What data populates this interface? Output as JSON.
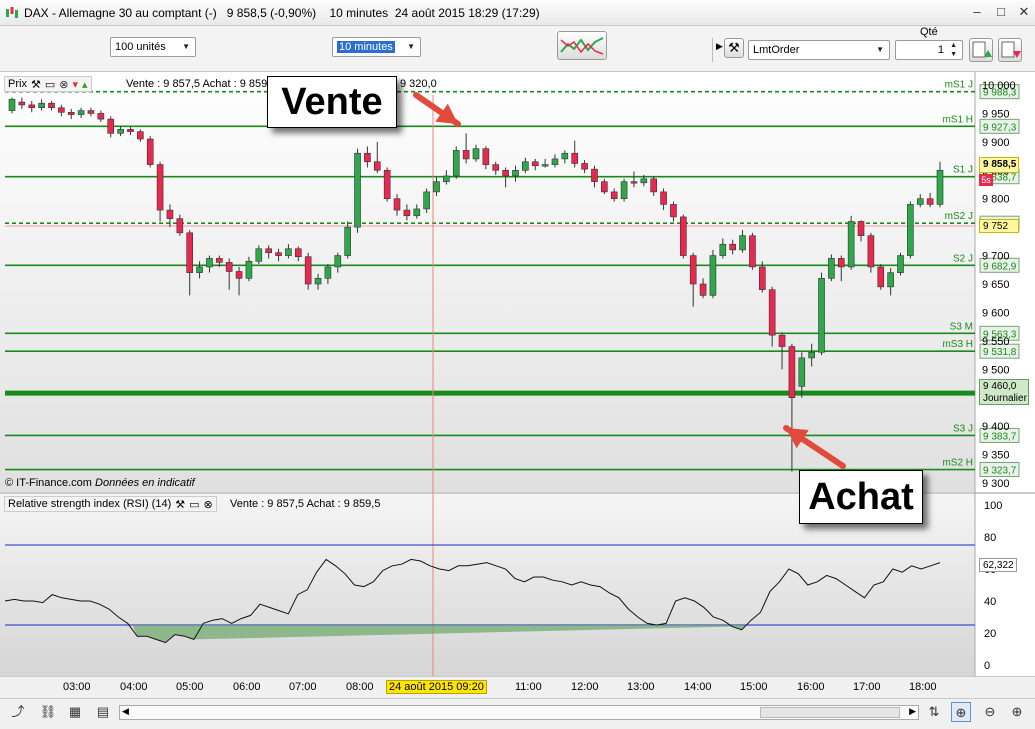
{
  "window": {
    "title": "DAX - Allemagne 30 au comptant (-)   9 858,5 (-0,90%)    10 minutes  24 août 2015 18:29 (17:29)",
    "min_symbol": "–",
    "max_symbol": "□",
    "close_symbol": "✕"
  },
  "toolbar": {
    "units_value": "100 unités",
    "interval_value": "10 minutes",
    "qty_label": "Qté",
    "order_type": "LmtOrder",
    "qty_value": "1"
  },
  "price_panel": {
    "title": "Prix",
    "quote_text": "Vente : 9 857,5 Achat : 9 859,",
    "quote_tail": "9 320,0",
    "copyright": "© IT-Finance.com",
    "disclaimer": "Données en indicatif",
    "y_ticks": [
      "10 000",
      "9 950",
      "9 900",
      "9 850",
      "9 800",
      "9 750",
      "9 700",
      "9 650",
      "9 600",
      "9 550",
      "9 500",
      "9 450",
      "9 400",
      "9 350",
      "9 300"
    ],
    "levels": [
      {
        "name": "mS1 J",
        "value": "9 988,3",
        "price": 9988.3,
        "style": "dashed"
      },
      {
        "name": "mS1 H",
        "value": "9 927,3",
        "price": 9927.3,
        "style": "solid"
      },
      {
        "name": "S1 J",
        "value": "9 838,7",
        "price": 9838.7,
        "style": "solid"
      },
      {
        "name": "mS2 J",
        "value": "9 752,8",
        "price": 9757,
        "style": "dashed"
      },
      {
        "name": "S2 J",
        "value": "9 682,9",
        "price": 9682.9,
        "style": "solid"
      },
      {
        "name": "S3 M",
        "value": "9 563,3",
        "price": 9563.3,
        "style": "solid"
      },
      {
        "name": "mS3 H",
        "value": "9 531,8",
        "price": 9531.8,
        "style": "solid"
      },
      {
        "name": "",
        "value": "9 460,0",
        "price": 9458,
        "style": "thick"
      },
      {
        "name": "S3 J",
        "value": "9 383,7",
        "price": 9383.7,
        "style": "solid"
      },
      {
        "name": "mS2 H",
        "value": "9 323,7",
        "price": 9323.7,
        "style": "solid"
      }
    ],
    "current_price": "9 858,5",
    "cursor_price": "9 752",
    "daily_label": "Journalier",
    "cursor_badge": "5s",
    "color_up": "#2ea84a",
    "color_down": "#e8284e",
    "level_color": "#1a8a1a"
  },
  "rsi_panel": {
    "title": "Relative strength index (RSI) (14)",
    "quote_text": "Vente : 9 857,5 Achat : 9 859,5",
    "y_ticks": [
      "100",
      "80",
      "60",
      "40",
      "20",
      "0"
    ],
    "current_value": "62,322",
    "upper_band": 75,
    "lower_band": 25,
    "values": [
      40,
      41,
      40,
      40,
      39,
      44,
      42,
      41,
      40,
      40,
      38,
      35,
      30,
      26,
      18,
      18,
      16,
      14,
      19,
      18,
      16,
      26,
      28,
      29,
      26,
      29,
      31,
      38,
      36,
      34,
      32,
      44,
      47,
      58,
      66,
      62,
      57,
      50,
      49,
      52,
      59,
      62,
      63,
      66,
      65,
      62,
      60,
      59,
      62,
      62,
      63,
      64,
      62,
      60,
      54,
      52,
      55,
      55,
      53,
      52,
      50,
      52,
      50,
      49,
      45,
      42,
      35,
      30,
      26,
      25,
      26,
      40,
      42,
      40,
      36,
      30,
      28,
      24,
      22,
      28,
      33,
      46,
      52,
      60,
      57,
      50,
      52,
      56,
      54,
      50,
      46,
      42,
      50,
      52,
      60,
      58,
      62,
      60,
      62,
      64
    ],
    "band_color": "#1c2ad0"
  },
  "x_axis": {
    "ticks": [
      "03:00",
      "04:00",
      "05:00",
      "06:00",
      "07:00",
      "08:00",
      "11:00",
      "12:00",
      "13:00",
      "14:00",
      "15:00",
      "16:00",
      "17:00",
      "18:00"
    ],
    "cursor_label": "24 août 2015 09:20"
  },
  "annotations": {
    "sell_label": "Vente",
    "buy_label": "Achat",
    "arrow_color": "#e24b3b"
  },
  "candles": [
    [
      9955,
      9975,
      9950,
      9978
    ],
    [
      9970,
      9965,
      9958,
      9978
    ],
    [
      9965,
      9960,
      9952,
      9972
    ],
    [
      9960,
      9968,
      9955,
      9975
    ],
    [
      9968,
      9960,
      9955,
      9972
    ],
    [
      9960,
      9952,
      9945,
      9965
    ],
    [
      9952,
      9948,
      9940,
      9958
    ],
    [
      9948,
      9955,
      9942,
      9960
    ],
    [
      9955,
      9950,
      9945,
      9960
    ],
    [
      9950,
      9940,
      9935,
      9955
    ],
    [
      9940,
      9915,
      9908,
      9945
    ],
    [
      9915,
      9922,
      9910,
      9928
    ],
    [
      9922,
      9918,
      9912,
      9926
    ],
    [
      9918,
      9905,
      9900,
      9922
    ],
    [
      9905,
      9860,
      9855,
      9910
    ],
    [
      9860,
      9780,
      9760,
      9865
    ],
    [
      9780,
      9765,
      9750,
      9790
    ],
    [
      9765,
      9740,
      9735,
      9772
    ],
    [
      9740,
      9670,
      9630,
      9745
    ],
    [
      9670,
      9680,
      9660,
      9690
    ],
    [
      9680,
      9695,
      9670,
      9700
    ],
    [
      9695,
      9688,
      9680,
      9700
    ],
    [
      9688,
      9672,
      9640,
      9695
    ],
    [
      9672,
      9660,
      9630,
      9680
    ],
    [
      9660,
      9690,
      9655,
      9698
    ],
    [
      9690,
      9712,
      9685,
      9718
    ],
    [
      9712,
      9705,
      9695,
      9718
    ],
    [
      9705,
      9700,
      9690,
      9712
    ],
    [
      9700,
      9712,
      9695,
      9720
    ],
    [
      9712,
      9698,
      9690,
      9716
    ],
    [
      9698,
      9650,
      9640,
      9705
    ],
    [
      9650,
      9660,
      9640,
      9668
    ],
    [
      9660,
      9680,
      9650,
      9685
    ],
    [
      9680,
      9700,
      9670,
      9705
    ],
    [
      9700,
      9750,
      9695,
      9760
    ],
    [
      9750,
      9880,
      9740,
      9888
    ],
    [
      9880,
      9865,
      9855,
      9892
    ],
    [
      9865,
      9850,
      9845,
      9900
    ],
    [
      9850,
      9800,
      9795,
      9855
    ],
    [
      9800,
      9780,
      9770,
      9808
    ],
    [
      9780,
      9770,
      9762,
      9790
    ],
    [
      9770,
      9782,
      9765,
      9790
    ],
    [
      9782,
      9812,
      9775,
      9818
    ],
    [
      9812,
      9830,
      9805,
      9838
    ],
    [
      9830,
      9840,
      9825,
      9850
    ],
    [
      9840,
      9885,
      9835,
      9892
    ],
    [
      9885,
      9870,
      9862,
      9915
    ],
    [
      9870,
      9888,
      9865,
      9895
    ],
    [
      9888,
      9860,
      9852,
      9892
    ],
    [
      9860,
      9850,
      9842,
      9865
    ],
    [
      9850,
      9840,
      9820,
      9855
    ],
    [
      9840,
      9850,
      9830,
      9858
    ],
    [
      9850,
      9865,
      9845,
      9872
    ],
    [
      9865,
      9858,
      9850,
      9870
    ],
    [
      9858,
      9860,
      9855,
      9870
    ],
    [
      9860,
      9870,
      9855,
      9878
    ],
    [
      9870,
      9880,
      9862,
      9885
    ],
    [
      9880,
      9862,
      9855,
      9902
    ],
    [
      9862,
      9852,
      9845,
      9868
    ],
    [
      9852,
      9830,
      9820,
      9858
    ],
    [
      9830,
      9812,
      9808,
      9835
    ],
    [
      9812,
      9800,
      9795,
      9818
    ],
    [
      9800,
      9830,
      9795,
      9835
    ],
    [
      9830,
      9828,
      9820,
      9848
    ],
    [
      9828,
      9835,
      9822,
      9842
    ],
    [
      9835,
      9812,
      9805,
      9840
    ],
    [
      9812,
      9790,
      9780,
      9818
    ],
    [
      9790,
      9768,
      9760,
      9795
    ],
    [
      9768,
      9700,
      9695,
      9772
    ],
    [
      9700,
      9650,
      9610,
      9705
    ],
    [
      9650,
      9630,
      9625,
      9660
    ],
    [
      9630,
      9700,
      9625,
      9710
    ],
    [
      9700,
      9720,
      9695,
      9730
    ],
    [
      9720,
      9710,
      9702,
      9728
    ],
    [
      9710,
      9735,
      9705,
      9745
    ],
    [
      9735,
      9680,
      9675,
      9740
    ],
    [
      9680,
      9640,
      9635,
      9690
    ],
    [
      9640,
      9560,
      9540,
      9645
    ],
    [
      9560,
      9540,
      9500,
      9565
    ],
    [
      9540,
      9450,
      9320,
      9545
    ],
    [
      9470,
      9520,
      9450,
      9530
    ],
    [
      9520,
      9530,
      9505,
      9545
    ],
    [
      9530,
      9660,
      9525,
      9670
    ],
    [
      9660,
      9695,
      9655,
      9702
    ],
    [
      9695,
      9680,
      9655,
      9700
    ],
    [
      9680,
      9760,
      9675,
      9770
    ],
    [
      9760,
      9735,
      9725,
      9762
    ],
    [
      9735,
      9680,
      9670,
      9740
    ],
    [
      9680,
      9645,
      9640,
      9685
    ],
    [
      9645,
      9670,
      9630,
      9678
    ],
    [
      9670,
      9700,
      9665,
      9705
    ],
    [
      9700,
      9790,
      9695,
      9795
    ],
    [
      9790,
      9800,
      9785,
      9808
    ],
    [
      9800,
      9790,
      9785,
      9810
    ],
    [
      9790,
      9850,
      9785,
      9865
    ]
  ]
}
